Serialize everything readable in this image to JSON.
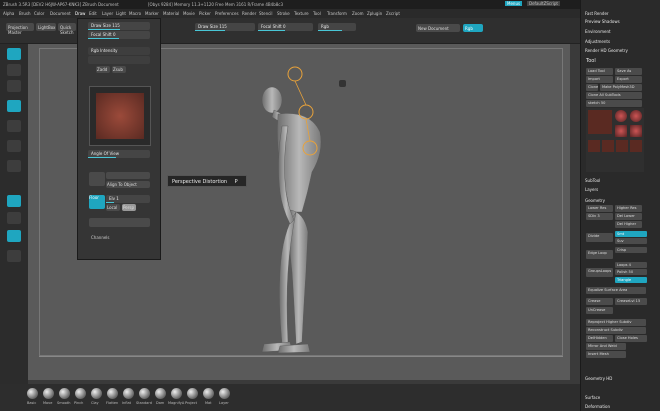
{
  "titlebar": {
    "app": "ZBrush 3.5R3 [DEV2 H6JW-AP67-KNK3]  ZBrush Document",
    "mem": "[Obys 9284]  Memory 11.3+1120  Free Mem 3161  R/Frame 4B4b8c3",
    "menu_btn": "Menus",
    "script_btn": "DefaultZScript"
  },
  "menu": [
    "Alpha",
    "Brush",
    "Color",
    "Document",
    "Draw",
    "Edit",
    "Layer",
    "Light",
    "Macro",
    "Marker",
    "Material",
    "Movie",
    "Picker",
    "Preferences",
    "Render",
    "Stencil",
    "Stroke",
    "Texture",
    "Tool",
    "Transform",
    "Zoom",
    "Zplugin",
    "Zscript"
  ],
  "shelf": {
    "projection_master": "Projection Master",
    "lightbox": "LightBox",
    "quick_sketch": "Quick Sketch",
    "draw_size_top": "Draw Size 115",
    "focal_shift_top": "Focal Shift 0",
    "rgb": "Rgb",
    "new_document": "New Document",
    "rgb_intensity": "Rgb Intensity 100",
    "z_intensity": "Z Intensity 25"
  },
  "draw_palette": {
    "draw_size": "Draw Size 115",
    "focal_shift": "Focal Shift 0",
    "rgb_intensity": "Rgb Intensity",
    "zadd": "Zadd",
    "zsub": "Zsub",
    "angle_of_view": "Angle Of View",
    "align_to_object": "Align To Object",
    "persp": "Persp",
    "floor": "Floor",
    "local": "Local",
    "elv": "Elv 1",
    "channels": "Channels"
  },
  "tooltip": {
    "label": "Perspective Distortion",
    "shortcut": "P"
  },
  "right": {
    "fast_render": "Fast Render",
    "preview_shadows": "Preview Shadows",
    "environment": "Environment",
    "adjustments": "Adjustments",
    "render_hd": "Render HD Geometry",
    "tool": "Tool",
    "load_tool": "Load Tool",
    "save_as": "Save As",
    "import": "Import",
    "export": "Export",
    "clone": "Clone",
    "make_polymesh": "Make PolyMesh3D",
    "clone_all": "Clone All SubTools",
    "sketch_val": "sketch 50",
    "thumbs": [
      "Sphere3D_1",
      "Cylinder3D",
      "Simple Brush",
      "PolyMesh3D",
      "Plane3D",
      "Sphere3D"
    ],
    "subtool": "SubTool",
    "layers": "Layers",
    "geometry": "Geometry",
    "lower_res": "Lower Res",
    "higher_res": "Higher Res",
    "sdiv": "SDiv 3",
    "del_lower": "Del Lower",
    "del_higher": "Del Higher",
    "divide": "Divide",
    "smt": "Smt",
    "suv": "Suv",
    "edge_loop": "Edge Loop",
    "crisp": "Crisp",
    "groups_loops": "GroupsLoops",
    "loops": "Loops 4",
    "polish": "Polish 50",
    "triangle": "Triangle",
    "equalize": "Equalize Surface Area",
    "crease": "Crease",
    "crease_lvl": "CreaseLvl 15",
    "uncrease": "UnCrease",
    "reproject": "Reproject Higher Subdiv",
    "reconstruct": "Reconstruct Subdiv",
    "del_hidden": "DelHidden",
    "close_holes": "Close Holes",
    "mirror_weld": "Mirror And Weld",
    "insert_mesh": "Insert Mesh",
    "hd_geometry": "Geometry HD",
    "surface": "Surface",
    "deformation": "Deformation"
  },
  "brushes": [
    "Basic",
    "Move",
    "Smooth",
    "Pinch",
    "Clay",
    "Flatten",
    "Inflat",
    "Standard",
    "Dam",
    "MagnifyA",
    "Project",
    "Mat",
    "Layer"
  ],
  "colors": {
    "accent": "#1fa6c0",
    "bg": "#3a3a3a",
    "canvas": "#5a5a5a"
  }
}
